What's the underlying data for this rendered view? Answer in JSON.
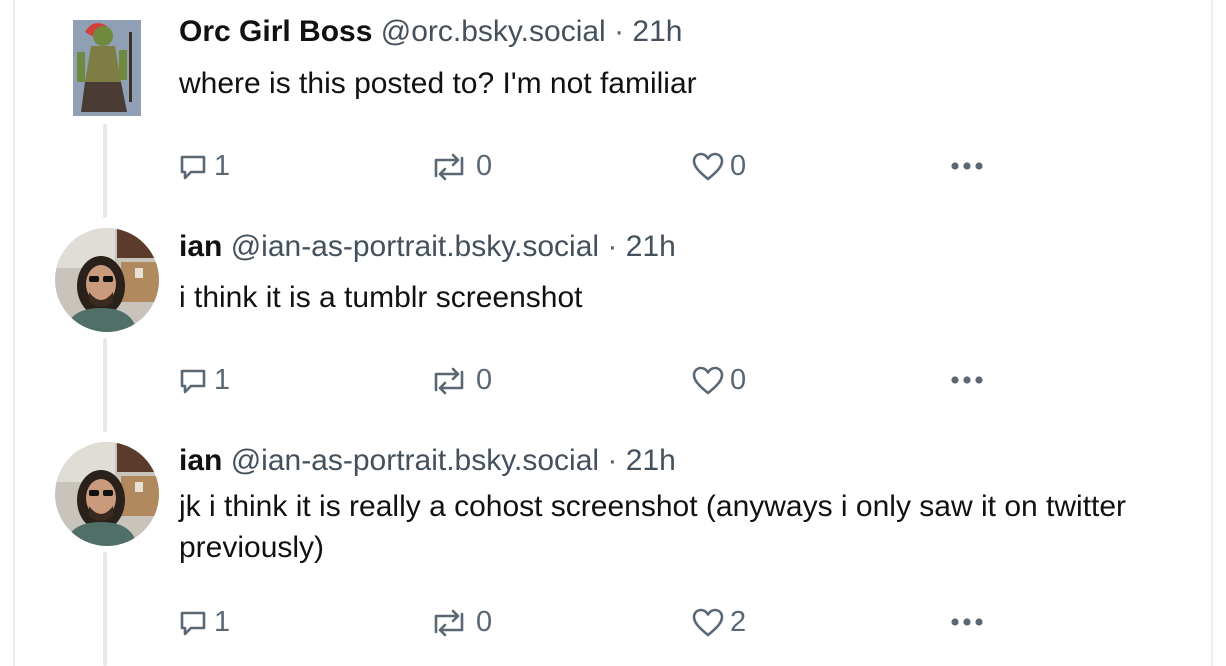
{
  "posts": [
    {
      "author_name": "Orc Girl Boss",
      "handle": "@orc.bsky.social",
      "separator": "·",
      "time": "21h",
      "text": "where is this posted to? I'm not familiar",
      "replies": "1",
      "reposts": "0",
      "likes": "0",
      "avatar_icon": "orc-character-avatar"
    },
    {
      "author_name": "ian",
      "handle": "@ian-as-portrait.bsky.social",
      "separator": "·",
      "time": "21h",
      "text": "i think it is a tumblr screenshot",
      "replies": "1",
      "reposts": "0",
      "likes": "0",
      "avatar_icon": "portrait-photo-avatar"
    },
    {
      "author_name": "ian",
      "handle": "@ian-as-portrait.bsky.social",
      "separator": "·",
      "time": "21h",
      "text": "jk i think it is really a cohost screenshot (anyways i only saw it on twitter previously)",
      "replies": "1",
      "reposts": "0",
      "likes": "2",
      "avatar_icon": "portrait-photo-avatar"
    }
  ],
  "colors": {
    "text": "#111111",
    "muted": "#5a6775",
    "thread_line": "#e4e7eb"
  },
  "icons": {
    "reply": "speech-bubble-icon",
    "repost": "repost-arrows-icon",
    "like": "heart-icon",
    "more": "ellipsis-icon"
  }
}
